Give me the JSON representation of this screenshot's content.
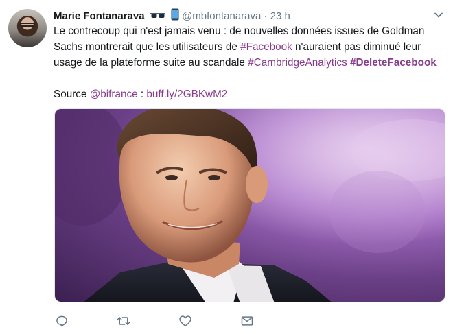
{
  "tweet": {
    "author_name": "Marie Fontanarava",
    "handle": "@mbfontanarava",
    "separator": "·",
    "time": "23 h",
    "text_segments": {
      "s1": "Le contrecoup qui n'est jamais venu : de nouvelles données issues de Goldman Sachs montrerait que les utilisateurs de ",
      "h1": "#Facebook",
      "s2": " n'auraient pas diminué leur usage de la plateforme suite au scandale ",
      "h2": "#CambridgeAnalytics",
      "s3": " ",
      "h3": "#DeleteFacebook"
    },
    "source": {
      "label": "Source ",
      "mention": "@bifrance",
      "sep": " : ",
      "link": "buff.ly/2GBKwM2"
    }
  },
  "icons": {
    "header_emojis": [
      "sunglasses-icon",
      "mobile-phone-icon"
    ],
    "caret": "chevron-down-icon",
    "actions": [
      "reply-icon",
      "retweet-icon",
      "like-icon",
      "direct-message-icon"
    ]
  },
  "colors": {
    "link": "#8a3b8f",
    "secondary": "#657786",
    "text": "#14171a"
  }
}
